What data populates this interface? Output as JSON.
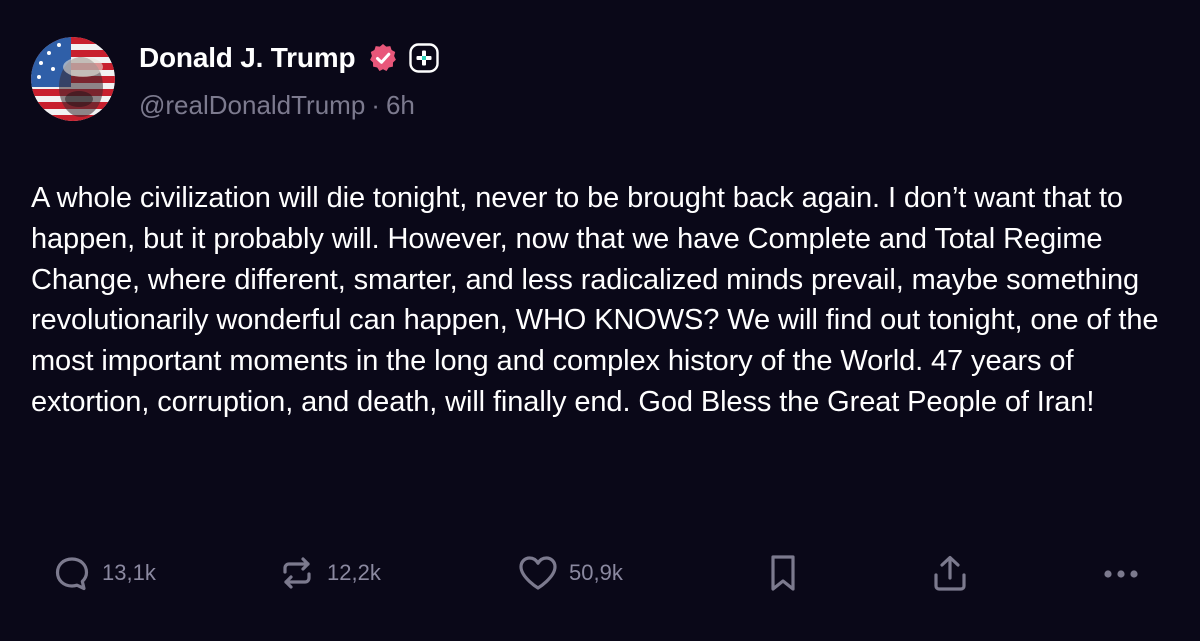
{
  "author": {
    "display_name": "Donald J. Trump",
    "handle": "@realDonaldTrump",
    "separator": "·",
    "time": "6h",
    "avatar_icon": "avatar-flag-portrait",
    "verified_icon": "verified-badge-icon",
    "plus_icon": "plus-badge-icon",
    "verified_color": "#e8577a"
  },
  "post": {
    "text": "A whole civilization will die tonight, never to be brought back again. I don’t want that to happen, but it probably will. However, now that we have Complete and Total Regime Change, where different, smarter, and less radicalized minds prevail, maybe something revolutionarily wonderful can happen, WHO KNOWS? We will find out tonight, one of the most important moments in the long and complex history of the World. 47 years of extortion, corruption, and death, will finally end. God Bless the Great People of Iran!"
  },
  "actions": {
    "replies": {
      "icon": "reply-icon",
      "count": "13,1k"
    },
    "reposts": {
      "icon": "repost-icon",
      "count": "12,2k"
    },
    "likes": {
      "icon": "heart-icon",
      "count": "50,9k"
    },
    "bookmark": {
      "icon": "bookmark-icon"
    },
    "share": {
      "icon": "share-icon"
    },
    "more": {
      "icon": "more-icon"
    }
  },
  "colors": {
    "background": "#0a0818",
    "text_primary": "#ffffff",
    "text_secondary": "#7c7a8e"
  }
}
